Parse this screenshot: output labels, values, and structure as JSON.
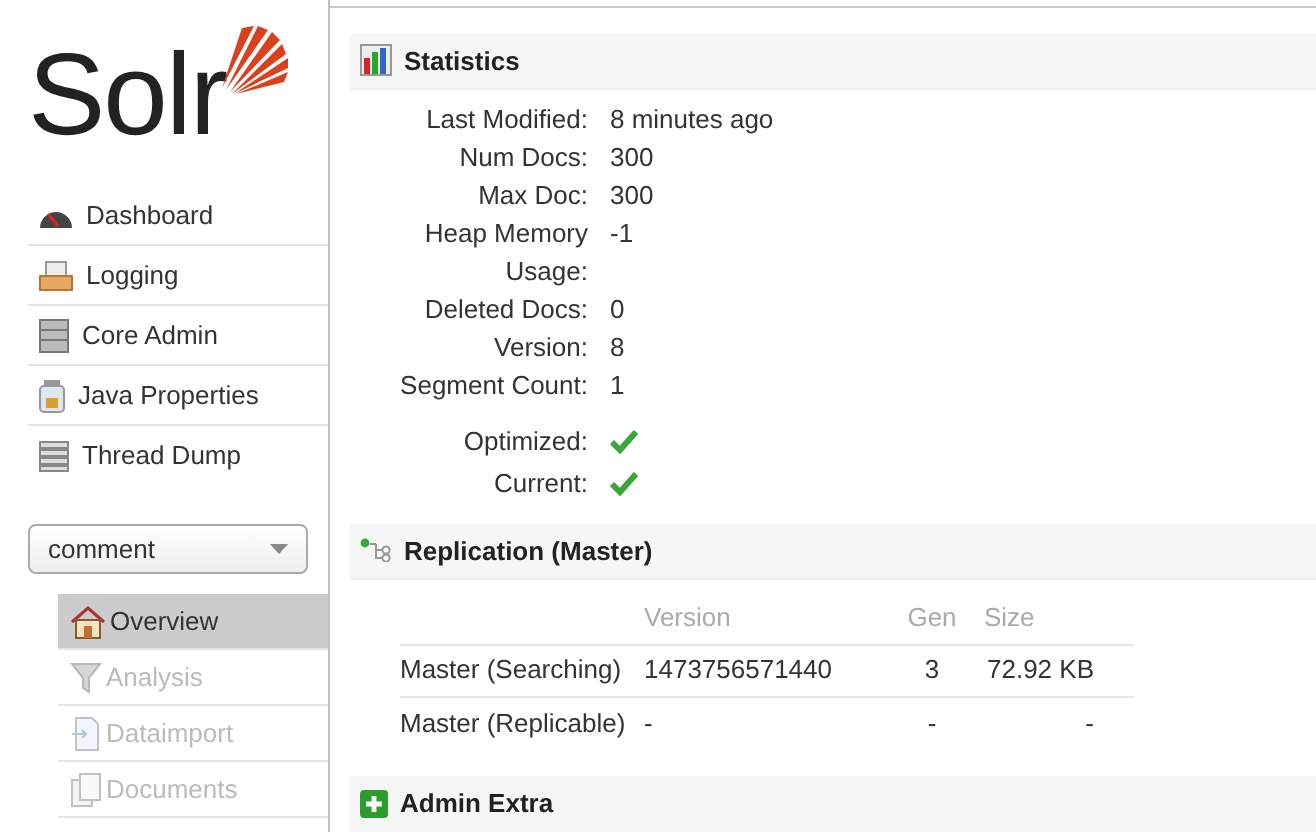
{
  "logo": {
    "text": "Solr"
  },
  "nav": [
    {
      "label": "Dashboard"
    },
    {
      "label": "Logging"
    },
    {
      "label": "Core Admin"
    },
    {
      "label": "Java Properties"
    },
    {
      "label": "Thread Dump"
    }
  ],
  "core_selector": {
    "value": "comment"
  },
  "core_menu": [
    {
      "label": "Overview",
      "selected": true,
      "disabled": false
    },
    {
      "label": "Analysis",
      "selected": false,
      "disabled": true
    },
    {
      "label": "Dataimport",
      "selected": false,
      "disabled": true
    },
    {
      "label": "Documents",
      "selected": false,
      "disabled": true
    }
  ],
  "statistics": {
    "title": "Statistics",
    "rows": [
      {
        "kind": "text",
        "label": "Last Modified:",
        "value": "8 minutes ago"
      },
      {
        "kind": "text",
        "label": "Num Docs:",
        "value": "300"
      },
      {
        "kind": "text",
        "label": "Max Doc:",
        "value": "300"
      },
      {
        "kind": "text",
        "label": "Heap Memory",
        "value": "-1"
      },
      {
        "kind": "text",
        "label": "Usage:"
      },
      {
        "kind": "text",
        "label": "Deleted Docs:",
        "value": "0"
      },
      {
        "kind": "text",
        "label": "Version:",
        "value": "8"
      },
      {
        "kind": "text",
        "label": "Segment Count:",
        "value": "1"
      },
      {
        "kind": "check",
        "label": "Optimized:",
        "checked": true
      },
      {
        "kind": "check",
        "label": "Current:",
        "checked": true
      }
    ]
  },
  "replication": {
    "title": "Replication (Master)",
    "columns": [
      "",
      "Version",
      "Gen",
      "Size"
    ],
    "rows": [
      [
        "Master (Searching)",
        "1473756571440",
        "3",
        "72.92 KB"
      ],
      [
        "Master (Replicable)",
        "-",
        "-",
        "-"
      ]
    ]
  },
  "admin_extra": {
    "title": "Admin Extra"
  }
}
